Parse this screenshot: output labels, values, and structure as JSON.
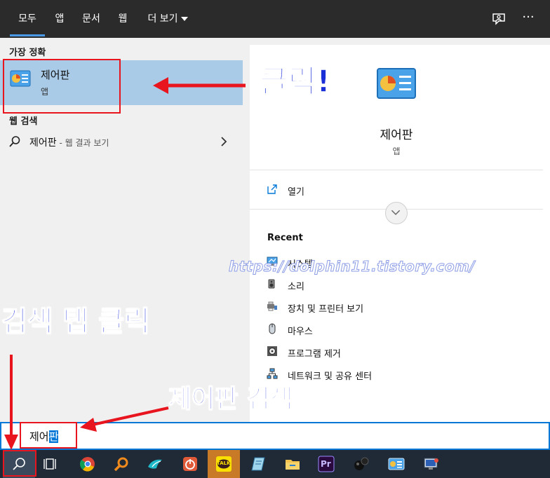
{
  "tabs": [
    {
      "label": "모두",
      "active": true
    },
    {
      "label": "앱"
    },
    {
      "label": "문서"
    },
    {
      "label": "웹"
    },
    {
      "label": "더 보기"
    }
  ],
  "top_icons": [
    "feedback-icon",
    "more-icon"
  ],
  "top_icons_text": {
    "more": "···"
  },
  "left": {
    "best_match_header": "가장 정확",
    "best_match": {
      "title": "제어판",
      "subtitle": "앱"
    },
    "web_header": "웹 검색",
    "web_result": {
      "title": "제어판",
      "subtitle": " - 웹 결과 보기"
    }
  },
  "right": {
    "title": "제어판",
    "subtitle": "앱",
    "open_label": "열기",
    "recent_header": "Recent",
    "recent_items": [
      {
        "label": "시스템",
        "icon": "system-icon"
      },
      {
        "label": "소리",
        "icon": "speaker-icon"
      },
      {
        "label": "장치 및 프린터 보기",
        "icon": "printer-icon"
      },
      {
        "label": "마우스",
        "icon": "mouse-icon"
      },
      {
        "label": "프로그램 제거",
        "icon": "program-icon"
      },
      {
        "label": "네트워크 및 공유 센터",
        "icon": "network-icon"
      }
    ]
  },
  "search": {
    "typed": "제어",
    "selected": "판"
  },
  "taskbar": [
    "search-icon",
    "task-view-icon",
    "chrome-icon",
    "search-app-icon",
    "bird-app-icon",
    "power-app-icon",
    "kakaotalk-icon",
    "notepad-icon",
    "file-explorer-icon",
    "premiere-icon",
    "media-app-icon",
    "control-panel-icon",
    "network-app-icon"
  ],
  "taskbar_text": {
    "kakaotalk": "TALK",
    "premiere": "Pr"
  },
  "annotations": {
    "click": "클릭!",
    "search_tab_click": "검색 탭 클릭",
    "search_control_panel": "제어판 검색",
    "watermark": "https://dolphin11.tistory.com/"
  },
  "colors": {
    "accent": "#0078d7",
    "highlight": "#a9cbe8",
    "taskbar": "#1f2a36",
    "topbar": "#2b2b2b",
    "annotation_red": "#e8141e",
    "annotation_blue": "#1b2fd9"
  }
}
